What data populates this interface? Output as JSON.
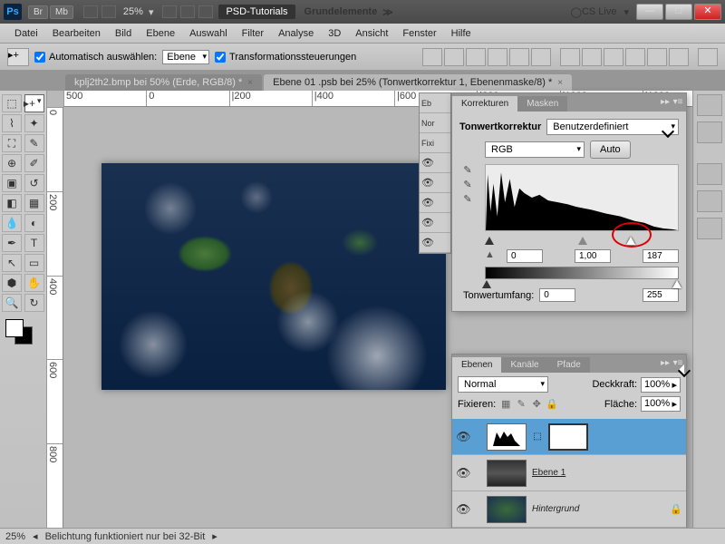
{
  "titlebar": {
    "br": "Br",
    "mb": "Mb",
    "zoom": "25%",
    "tag": "PSD-Tutorials",
    "subtitle": "Grundelemente",
    "cslive": "CS Live"
  },
  "menu": [
    "Datei",
    "Bearbeiten",
    "Bild",
    "Ebene",
    "Auswahl",
    "Filter",
    "Analyse",
    "3D",
    "Ansicht",
    "Fenster",
    "Hilfe"
  ],
  "options": {
    "auto_select": "Automatisch auswählen:",
    "auto_select_value": "Ebene",
    "transform": "Transformationssteuerungen"
  },
  "tabs": [
    {
      "label": "kplj2th2.bmp bei 50% (Erde, RGB/8) *",
      "active": false
    },
    {
      "label": "Ebene 01 .psb bei 25% (Tonwertkorrektur 1, Ebenenmaske/8) *",
      "active": true
    }
  ],
  "ruler_h": [
    "500",
    "0",
    "|200",
    "|400",
    "|600",
    "|800",
    "|1000",
    "|1200"
  ],
  "ruler_v": [
    "0",
    "200",
    "400",
    "600",
    "800"
  ],
  "hidden_panel": {
    "tabs": [
      "Eb"
    ],
    "rows": [
      "Nor",
      "Fixi"
    ]
  },
  "adjustments": {
    "tabs": [
      "Korrekturen",
      "Masken"
    ],
    "title": "Tonwertkorrektur",
    "preset": "Benutzerdefiniert",
    "channel": "RGB",
    "auto": "Auto",
    "input": {
      "black": "0",
      "gamma": "1,00",
      "white": "187"
    },
    "range_label": "Tonwertumfang:",
    "range": {
      "black": "0",
      "white": "255"
    }
  },
  "layers": {
    "tabs": [
      "Ebenen",
      "Kanäle",
      "Pfade"
    ],
    "blend": "Normal",
    "opacity_label": "Deckkraft:",
    "opacity": "100%",
    "lock_label": "Fixieren:",
    "fill_label": "Fläche:",
    "fill": "100%",
    "items": [
      {
        "name": "",
        "type": "levels"
      },
      {
        "name": "Ebene 1",
        "type": "normal"
      },
      {
        "name": "Hintergrund",
        "type": "bg"
      }
    ]
  },
  "status": {
    "zoom": "25%",
    "msg": "Belichtung funktioniert nur bei 32-Bit"
  }
}
